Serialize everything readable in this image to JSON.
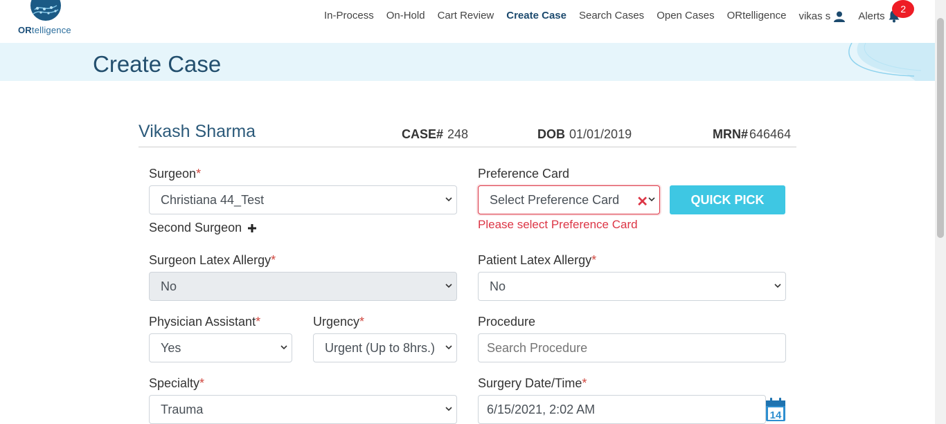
{
  "brand": {
    "logo_text_bold": "OR",
    "logo_text_rest": "telligence"
  },
  "nav": {
    "items": [
      "In-Process",
      "On-Hold",
      "Cart Review",
      "Create Case",
      "Search Cases",
      "Open Cases",
      "ORtelligence"
    ],
    "active": "Create Case",
    "user": "vikas s",
    "alerts_label": "Alerts",
    "alerts_count": "2"
  },
  "page": {
    "title": "Create Case"
  },
  "patient": {
    "name": "Vikash Sharma",
    "case_label": "CASE#",
    "case_value": "248",
    "dob_label": "DOB",
    "dob_value": "01/01/2019",
    "mrn_label": "MRN#",
    "mrn_value": "646464"
  },
  "form": {
    "surgeon_label": "Surgeon",
    "surgeon_value": "Christiana 44_Test",
    "second_surgeon_label": "Second Surgeon",
    "preference_label": "Preference Card",
    "preference_placeholder": "Select Preference Card",
    "preference_error": "Please select Preference Card",
    "quick_pick": "QUICK PICK",
    "surgeon_latex_label": "Surgeon Latex Allergy",
    "surgeon_latex_value": "No",
    "patient_latex_label": "Patient Latex Allergy",
    "patient_latex_value": "No",
    "pa_label": "Physician Assistant",
    "pa_value": "Yes",
    "urgency_label": "Urgency",
    "urgency_value": "Urgent (Up to 8hrs.)",
    "procedure_label": "Procedure",
    "procedure_placeholder": "Search Procedure",
    "specialty_label": "Specialty",
    "specialty_value": "Trauma",
    "surgery_date_label": "Surgery Date/Time",
    "surgery_date_value": "6/15/2021, 2:02 AM",
    "calendar_day": "14",
    "required_mark": "*"
  },
  "colors": {
    "accent": "#3ec7e3",
    "brand": "#1c4a6e",
    "error": "#dc3545",
    "banner": "#e6f5fb"
  }
}
